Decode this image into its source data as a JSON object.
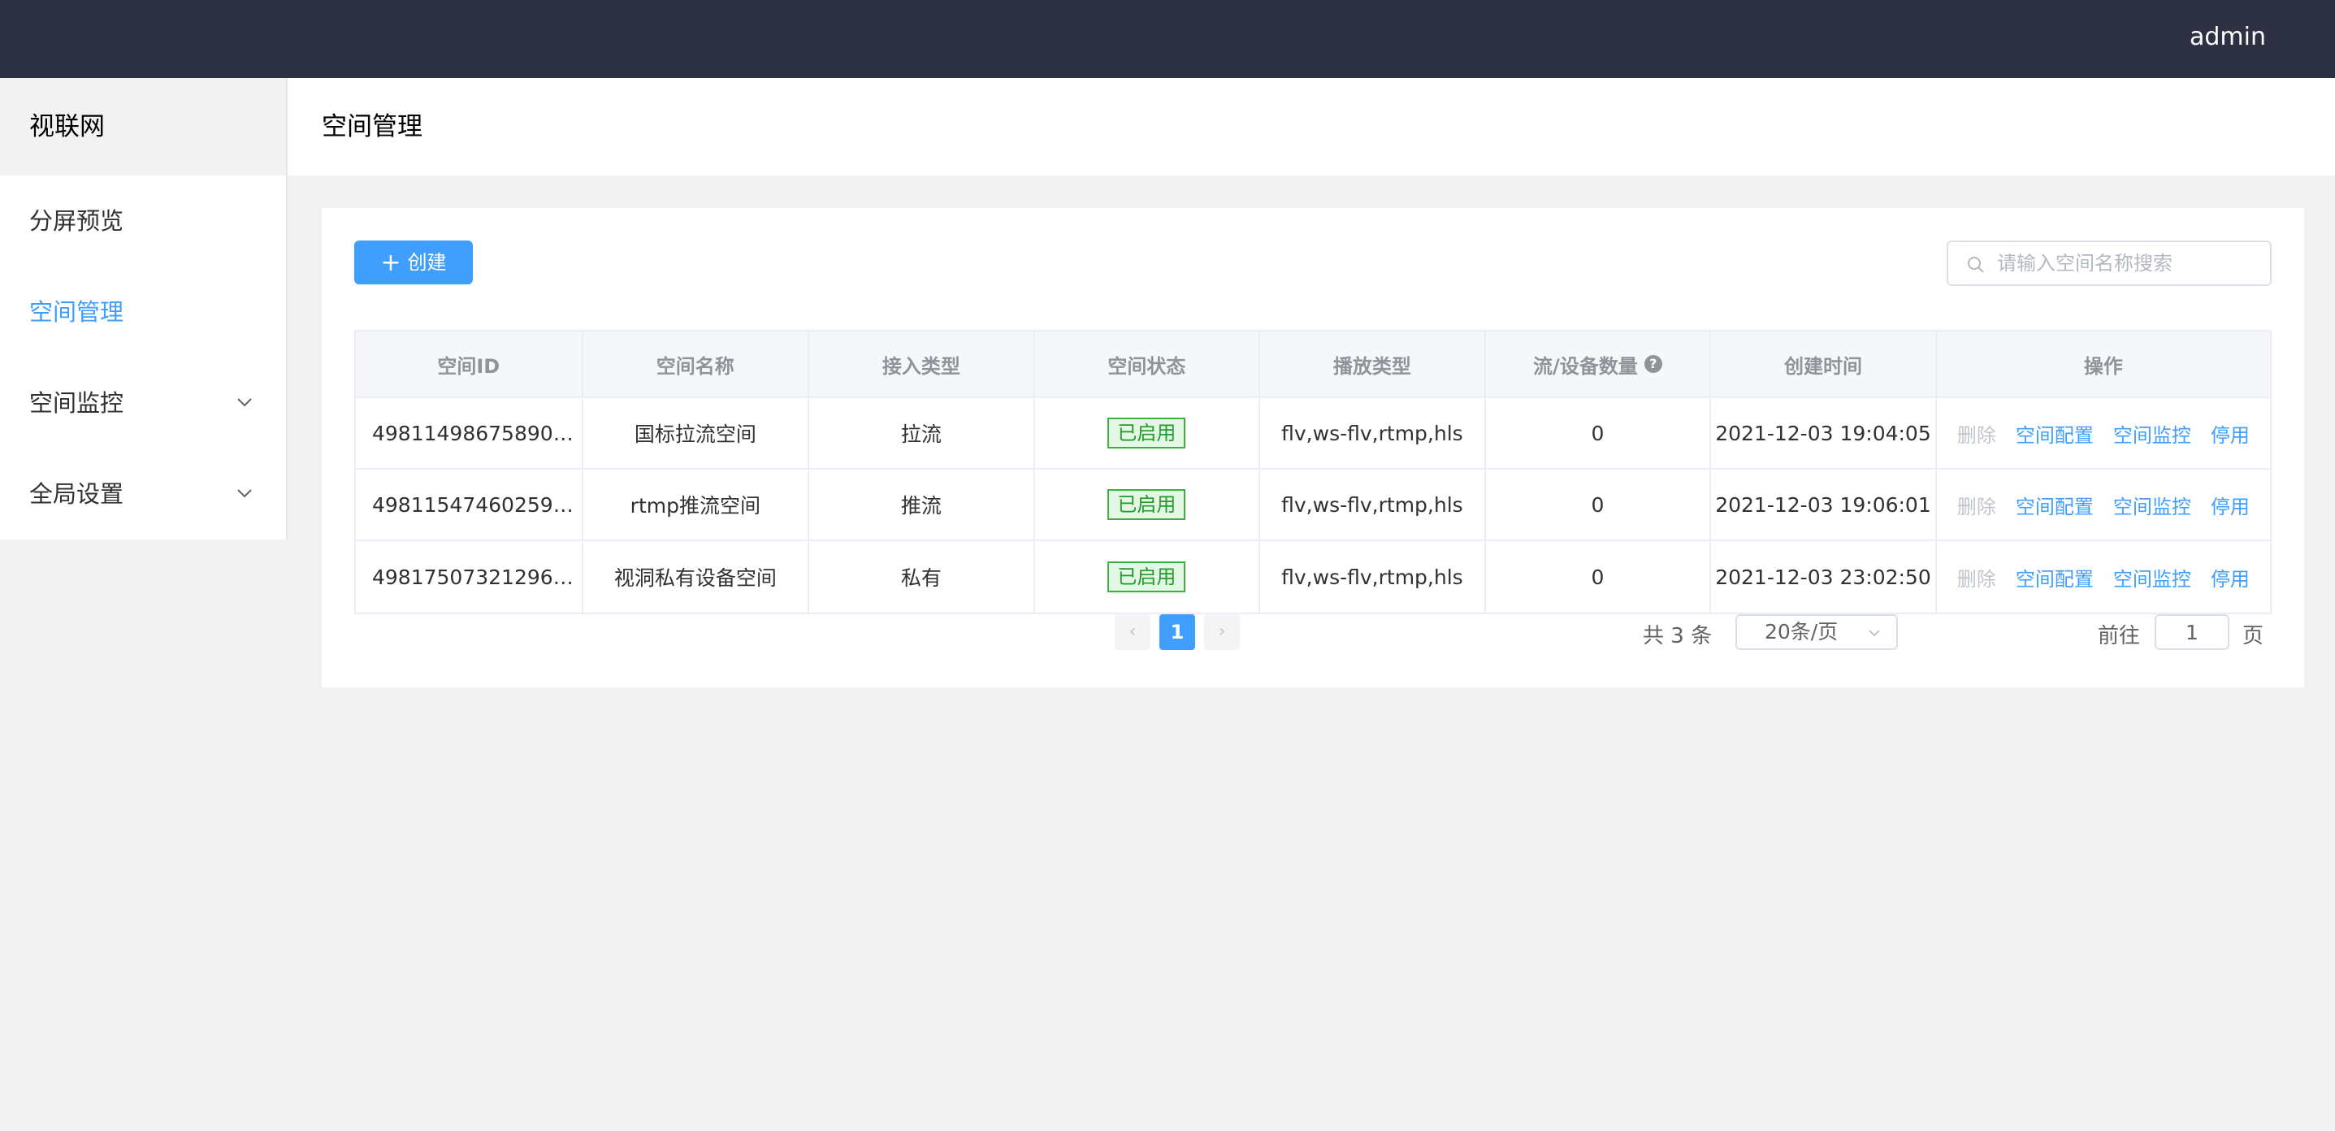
{
  "header": {
    "user": "admin"
  },
  "sidebar": {
    "brand": "视联网",
    "items": [
      {
        "label": "分屏预览",
        "active": false,
        "expandable": false
      },
      {
        "label": "空间管理",
        "active": true,
        "expandable": false
      },
      {
        "label": "空间监控",
        "active": false,
        "expandable": true
      },
      {
        "label": "全局设置",
        "active": false,
        "expandable": true
      }
    ]
  },
  "page": {
    "title": "空间管理"
  },
  "toolbar": {
    "create_plus": "+",
    "create_label": "创建",
    "search_placeholder": "请输入空间名称搜索"
  },
  "table": {
    "columns": [
      "空间ID",
      "空间名称",
      "接入类型",
      "空间状态",
      "播放类型",
      "流/设备数量",
      "创建时间",
      "操作"
    ],
    "help_glyph": "?",
    "rows": [
      {
        "id": "498114986758901...",
        "name": "国标拉流空间",
        "access": "拉流",
        "status": "已启用",
        "play": "flv,ws-flv,rtmp,hls",
        "count": "0",
        "created": "2021-12-03 19:04:05"
      },
      {
        "id": "498115474602594...",
        "name": "rtmp推流空间",
        "access": "推流",
        "status": "已启用",
        "play": "flv,ws-flv,rtmp,hls",
        "count": "0",
        "created": "2021-12-03 19:06:01"
      },
      {
        "id": "498175073212960...",
        "name": "视洞私有设备空间",
        "access": "私有",
        "status": "已启用",
        "play": "flv,ws-flv,rtmp,hls",
        "count": "0",
        "created": "2021-12-03 23:02:50"
      }
    ],
    "actions": {
      "delete": "删除",
      "config": "空间配置",
      "monitor": "空间监控",
      "disable": "停用"
    }
  },
  "pagination": {
    "total": "共 3 条",
    "page_size": "20条/页",
    "prev": "‹",
    "next": "›",
    "current": "1",
    "goto_label": "前往",
    "goto_value": "1",
    "page_suffix": "页"
  },
  "colors": {
    "accent": "#409eff",
    "topbar": "#2e3143",
    "tag_green": "#1f9c2a"
  }
}
